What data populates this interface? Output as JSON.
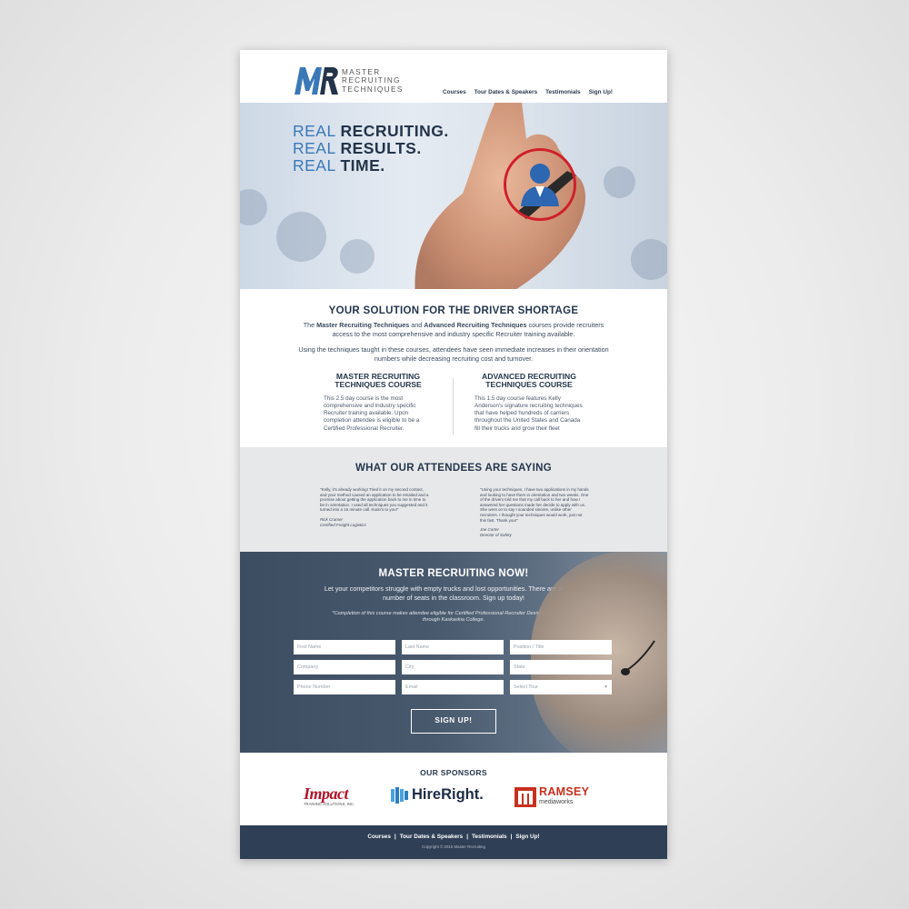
{
  "brand": {
    "logo_letters": "MR",
    "logo_words": [
      "MASTER",
      "RECRUITING",
      "TECHNIQUES"
    ],
    "colors": {
      "navy": "#25364b",
      "blue": "#3b78b8",
      "red": "#d0202a",
      "footer": "#2f3f55"
    }
  },
  "nav": [
    "Courses",
    "Tour Dates & Speakers",
    "Testimonials",
    "Sign Up!"
  ],
  "hero": {
    "lines": [
      {
        "thin": "REAL",
        "bold": "RECRUITING."
      },
      {
        "thin": "REAL",
        "bold": "RESULTS."
      },
      {
        "thin": "REAL",
        "bold": "TIME."
      }
    ]
  },
  "solution": {
    "title": "YOUR SOLUTION FOR THE DRIVER SHORTAGE",
    "p1_pre": "The ",
    "p1_strong1": "Master Recruiting Techniques",
    "p1_mid": " and ",
    "p1_strong2": "Advanced Recruiting Techniques",
    "p1_post": " courses provide recruiters access to the most comprehensive and industry specific Recruiter training available.",
    "p2": "Using the techniques taught in these courses, attendees have seen immediate increases in their orientation numbers while decreasing recruiting cost and turnover.",
    "courses": [
      {
        "title_1": "MASTER RECRUITING",
        "title_2": "TECHNIQUES COURSE",
        "desc": "This 2.5 day course is the most comprehensive and industry specific Recruiter training available. Upon completion attendee is eligible to be a Certified Professional Recruiter."
      },
      {
        "title_1": "ADVANCED RECRUITING",
        "title_2": "TECHNIQUES COURSE",
        "desc": "This 1.5 day course features Kelly Anderson's signature recruiting techniques that have helped hundreds of carriers throughout the United States and Canada fill their trucks and grow their fleet"
      }
    ]
  },
  "testimonials": {
    "title": "WHAT OUR ATTENDEES ARE SAYING",
    "items": [
      {
        "quote": "\"Kelly, it's already working! Tried it on my second contact, and your method caused an application to be emailed and a promise about getting the application back to me in time to be in orientation. I used all techniques you suggested and it turned into a 15 minute call. Kudo's to you!\"",
        "name": "Rick Cramer",
        "role": "Certified Freight Logistics"
      },
      {
        "quote": "\"Using your techniques, I have two applications in my hands and looking to have them in orientation and two weeks. One of the drivers told me that my call back to her and how I answered her questions made her decide to apply with us. She went on to say I sounded sincere, unlike other recruiters. I thought your techniques would work, just not this fast. Thank you!\"",
        "name": "Joe Carter",
        "role": "Director of Safety"
      }
    ]
  },
  "signup": {
    "title": "MASTER RECRUITING NOW!",
    "lead": "Let your competitors struggle with empty trucks and lost opportunities. There are a limited number of seats in the classroom. Sign up today!",
    "note": "*Completion of this course makes attendee eligible for Certified Professional Recruiter Designation available through Kaskaskia College.",
    "fields": {
      "first_name": "First Name",
      "last_name": "Last Name",
      "position": "Position / Title",
      "company": "Company",
      "city": "City",
      "state": "State",
      "phone": "Phone Number",
      "email": "Email",
      "tour": "Select Tour"
    },
    "submit": "SIGN UP!"
  },
  "sponsors": {
    "title": "OUR SPONSORS",
    "impact": {
      "name": "Impact",
      "sub": "TRAINING SOLUTIONS, INC."
    },
    "hireright": {
      "name": "HireRight."
    },
    "ramsey": {
      "name": "RAMSEY",
      "sub": "mediaworks"
    }
  },
  "footer": {
    "links": [
      "Courses",
      "Tour Dates & Speakers",
      "Testimonials",
      "Sign Up!"
    ],
    "separator": "|",
    "copyright": "Copyright © 2015 Master Recruiting"
  }
}
